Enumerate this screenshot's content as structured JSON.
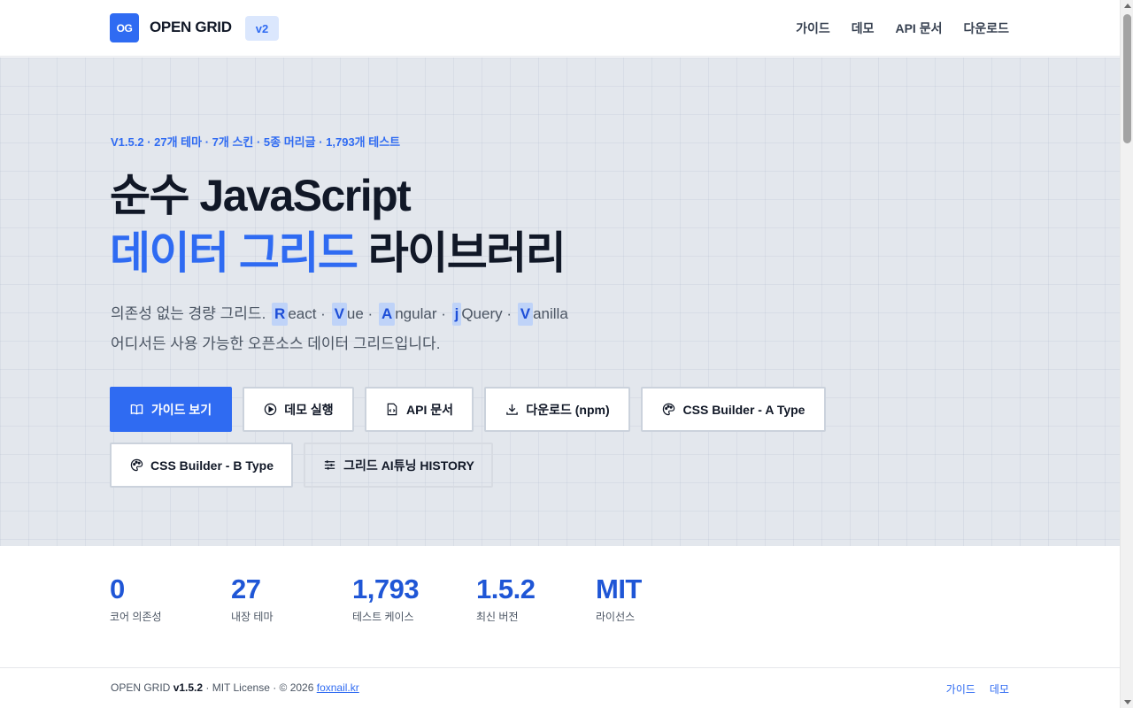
{
  "header": {
    "logo_text": "OG",
    "brand": "OPEN GRID",
    "version_badge": "v2",
    "nav": [
      "가이드",
      "데모",
      "API 문서",
      "다운로드"
    ]
  },
  "hero": {
    "tagline": "V1.5.2 · 27개 테마 · 7개 스킨 · 5종 머리글 · 1,793개 테스트",
    "title_line1": "순수 JavaScript",
    "title_accent": "데이터 그리드",
    "title_rest": " 라이브러리",
    "desc_prefix": "의존성 없는 경량 그리드.",
    "frameworks": [
      {
        "letter": "R",
        "rest": "eact",
        "sep": " · "
      },
      {
        "letter": "V",
        "rest": "ue",
        "sep": " · "
      },
      {
        "letter": "A",
        "rest": "ngular",
        "sep": " · "
      },
      {
        "letter": "j",
        "rest": "Query",
        "sep": " · "
      },
      {
        "letter": "V",
        "rest": "anilla",
        "sep": ""
      }
    ],
    "desc_line2": "어디서든 사용 가능한 오픈소스 데이터 그리드입니다.",
    "buttons": {
      "guide": "가이드 보기",
      "demo": "데모 실행",
      "api": "API 문서",
      "download": "다운로드 (npm)",
      "css_a": "CSS Builder - A Type",
      "css_b": "CSS Builder - B Type",
      "history": "그리드 AI튜닝 HISTORY"
    },
    "button_icons": {
      "guide": "book-icon",
      "demo": "play-icon",
      "api": "code-file-icon",
      "download": "download-icon",
      "css_a": "palette-icon",
      "css_b": "palette-icon",
      "history": "sliders-icon"
    }
  },
  "stats": [
    {
      "value": "0",
      "label": "코어 의존성"
    },
    {
      "value": "27",
      "label": "내장 테마"
    },
    {
      "value": "1,793",
      "label": "테스트 케이스"
    },
    {
      "value": "1.5.2",
      "label": "최신 버전"
    },
    {
      "value": "MIT",
      "label": "라이선스"
    }
  ],
  "footer": {
    "brand": "OPEN GRID",
    "version": "v1.5.2",
    "license_text": " · MIT License · © 2026 ",
    "site_link": "foxnail.kr",
    "links": [
      "가이드",
      "데모"
    ]
  },
  "colors": {
    "accent": "#2f6bf2",
    "stat_value": "#1f56d6",
    "hero_bg": "#e3e7ed"
  }
}
